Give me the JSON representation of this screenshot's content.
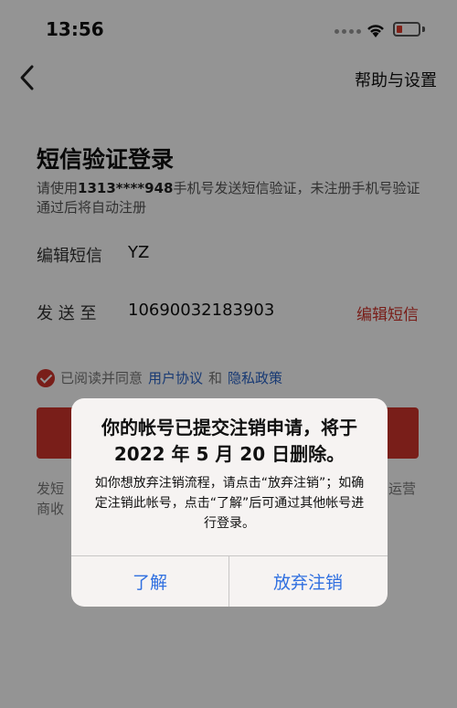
{
  "status_bar": {
    "time": "13:56"
  },
  "nav": {
    "right_label": "帮助与设置"
  },
  "page": {
    "title": "短信验证登录",
    "desc_prefix": "请使用",
    "phone": "1313****948",
    "desc_suffix": "手机号发送短信验证，未注册手机号验证通过后将自动注册"
  },
  "rows": {
    "edit_label": "编辑短信",
    "edit_value": "YZ",
    "send_label": "发 送 至",
    "send_value": "10690032183903",
    "edit_link": "编辑短信"
  },
  "agreement": {
    "prefix": "已阅读并同意",
    "user_agreement": "用户协议",
    "and": "和",
    "privacy": "隐私政策"
  },
  "footer": {
    "left_line1": "发短",
    "left_line2": "商收",
    "right": "运营"
  },
  "alert": {
    "title": "你的帐号已提交注销申请，将于 2022 年 5 月 20 日删除。",
    "message": "如你想放弃注销流程，请点击“放弃注销”；如确定注销此帐号，点击“了解”后可通过其他帐号进行登录。",
    "ok_label": "了解",
    "cancel_label": "放弃注销"
  },
  "colors": {
    "accent": "#d0342c",
    "link": "#2a64c8",
    "alert_button": "#2f6fe0"
  }
}
